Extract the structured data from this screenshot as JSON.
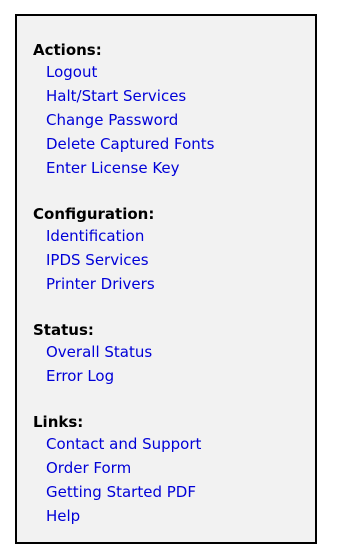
{
  "colors": {
    "panel_background": "#f2f2f2",
    "panel_border": "#000000",
    "heading_text": "#000000",
    "link_text": "#0000d8"
  },
  "sections": [
    {
      "title": "Actions:",
      "items": [
        "Logout",
        "Halt/Start Services",
        "Change Password",
        "Delete Captured Fonts",
        "Enter License Key"
      ]
    },
    {
      "title": "Configuration:",
      "items": [
        "Identification",
        "IPDS Services",
        "Printer Drivers"
      ]
    },
    {
      "title": "Status:",
      "items": [
        "Overall Status",
        "Error Log"
      ]
    },
    {
      "title": "Links:",
      "items": [
        "Contact and Support",
        "Order Form",
        "Getting Started PDF",
        "Help"
      ]
    }
  ]
}
